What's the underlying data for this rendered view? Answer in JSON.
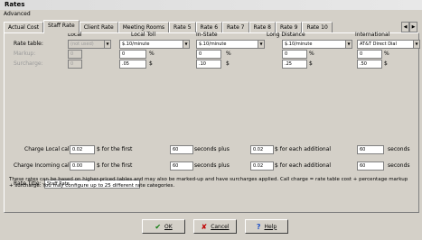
{
  "window": {
    "title": "Rates"
  },
  "menu": {
    "advanced": "Advanced"
  },
  "tabs": [
    "Actual Cost",
    "Staff Rate",
    "Client Rate",
    "Meeting Rooms",
    "Rate 5",
    "Rate 6",
    "Rate 7",
    "Rate 8",
    "Rate 9",
    "Rate 10"
  ],
  "columns": {
    "local": "Local",
    "local_toll": "Local Toll",
    "in_state": "In-State",
    "long_distance": "Long Distance",
    "international": "International"
  },
  "rows": {
    "rate_table": "Rate table:",
    "markup": "Markup:",
    "surcharge": "Surcharge:"
  },
  "rate_table": {
    "local": "(not used)",
    "local_toll": "$.10/minute",
    "in_state": "$.10/minute",
    "long_distance": "$.10/minute",
    "international": "AT&T Direct Dial"
  },
  "markup": {
    "local": "0",
    "local_toll": "0",
    "in_state": "0",
    "long_distance": "0",
    "international": "0",
    "unit": "%"
  },
  "surcharge": {
    "local": "0",
    "local_toll": ".05",
    "in_state": ".10",
    "long_distance": ".25",
    "international": ".50",
    "unit": "$"
  },
  "charge_local": {
    "label": "Charge Local calls",
    "amount": "0.02",
    "for_first": "$  for the first",
    "seconds": "60",
    "plus": "seconds plus",
    "additional_amount": "0.02",
    "each_additional": "$  for each additional",
    "add_seconds": "60",
    "seconds_label": "seconds"
  },
  "charge_incoming": {
    "label": "Charge Incoming calls",
    "amount": "0.00",
    "for_first": "$  for the first",
    "seconds": "60",
    "plus": "seconds plus",
    "additional_amount": "0.02",
    "each_additional": "$  for each additional",
    "add_seconds": "60",
    "seconds_label": "seconds"
  },
  "rate_title": {
    "label": "Rate Title:",
    "value": "Staff Rate"
  },
  "description": "These rates can be based on higher-priced tables and may also be marked-up and have surcharges applied. Call charge = rate table cost + percentage markup + surcharge. You may configure up to 25 different rate categories.",
  "buttons": {
    "ok": "OK",
    "cancel": "Cancel",
    "help": "Help"
  }
}
